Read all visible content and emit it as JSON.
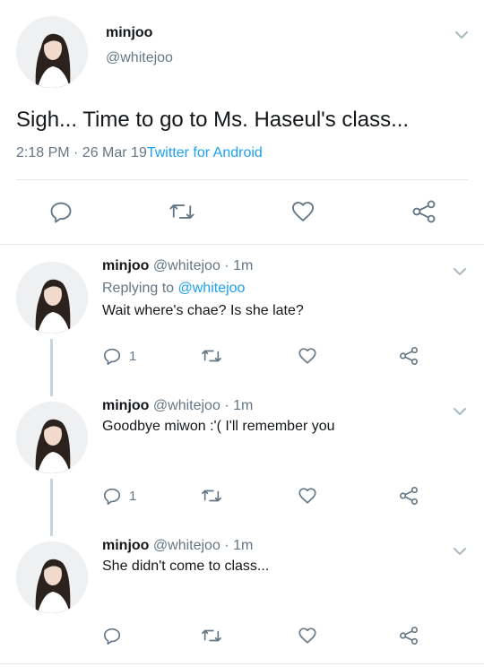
{
  "main_tweet": {
    "name": "minjoo",
    "handle": "@whitejoo",
    "text": "Sigh... Time to go to Ms. Haseul's class...",
    "timestamp": "2:18 PM · 26 Mar 19",
    "source": "Twitter for Android"
  },
  "replies": [
    {
      "name": "minjoo",
      "handle": "@whitejoo",
      "age": "· 1m",
      "replying_label": "Replying to",
      "replying_to": "@whitejoo",
      "text": "Wait where's chae? Is she late?",
      "reply_count": "1"
    },
    {
      "name": "minjoo",
      "handle": "@whitejoo",
      "age": "· 1m",
      "text": "Goodbye miwon :'( I'll remember you",
      "reply_count": "1"
    },
    {
      "name": "minjoo",
      "handle": "@whitejoo",
      "age": "· 1m",
      "text": "She didn't come to class..."
    }
  ],
  "icons": {
    "reply": "reply-icon",
    "retweet": "retweet-icon",
    "like": "heart-icon",
    "share": "share-icon",
    "more": "chevron-down-icon"
  },
  "colors": {
    "link": "#1da1f2",
    "muted": "#657786",
    "icon": "#657786",
    "divider": "#e1e8ed"
  }
}
